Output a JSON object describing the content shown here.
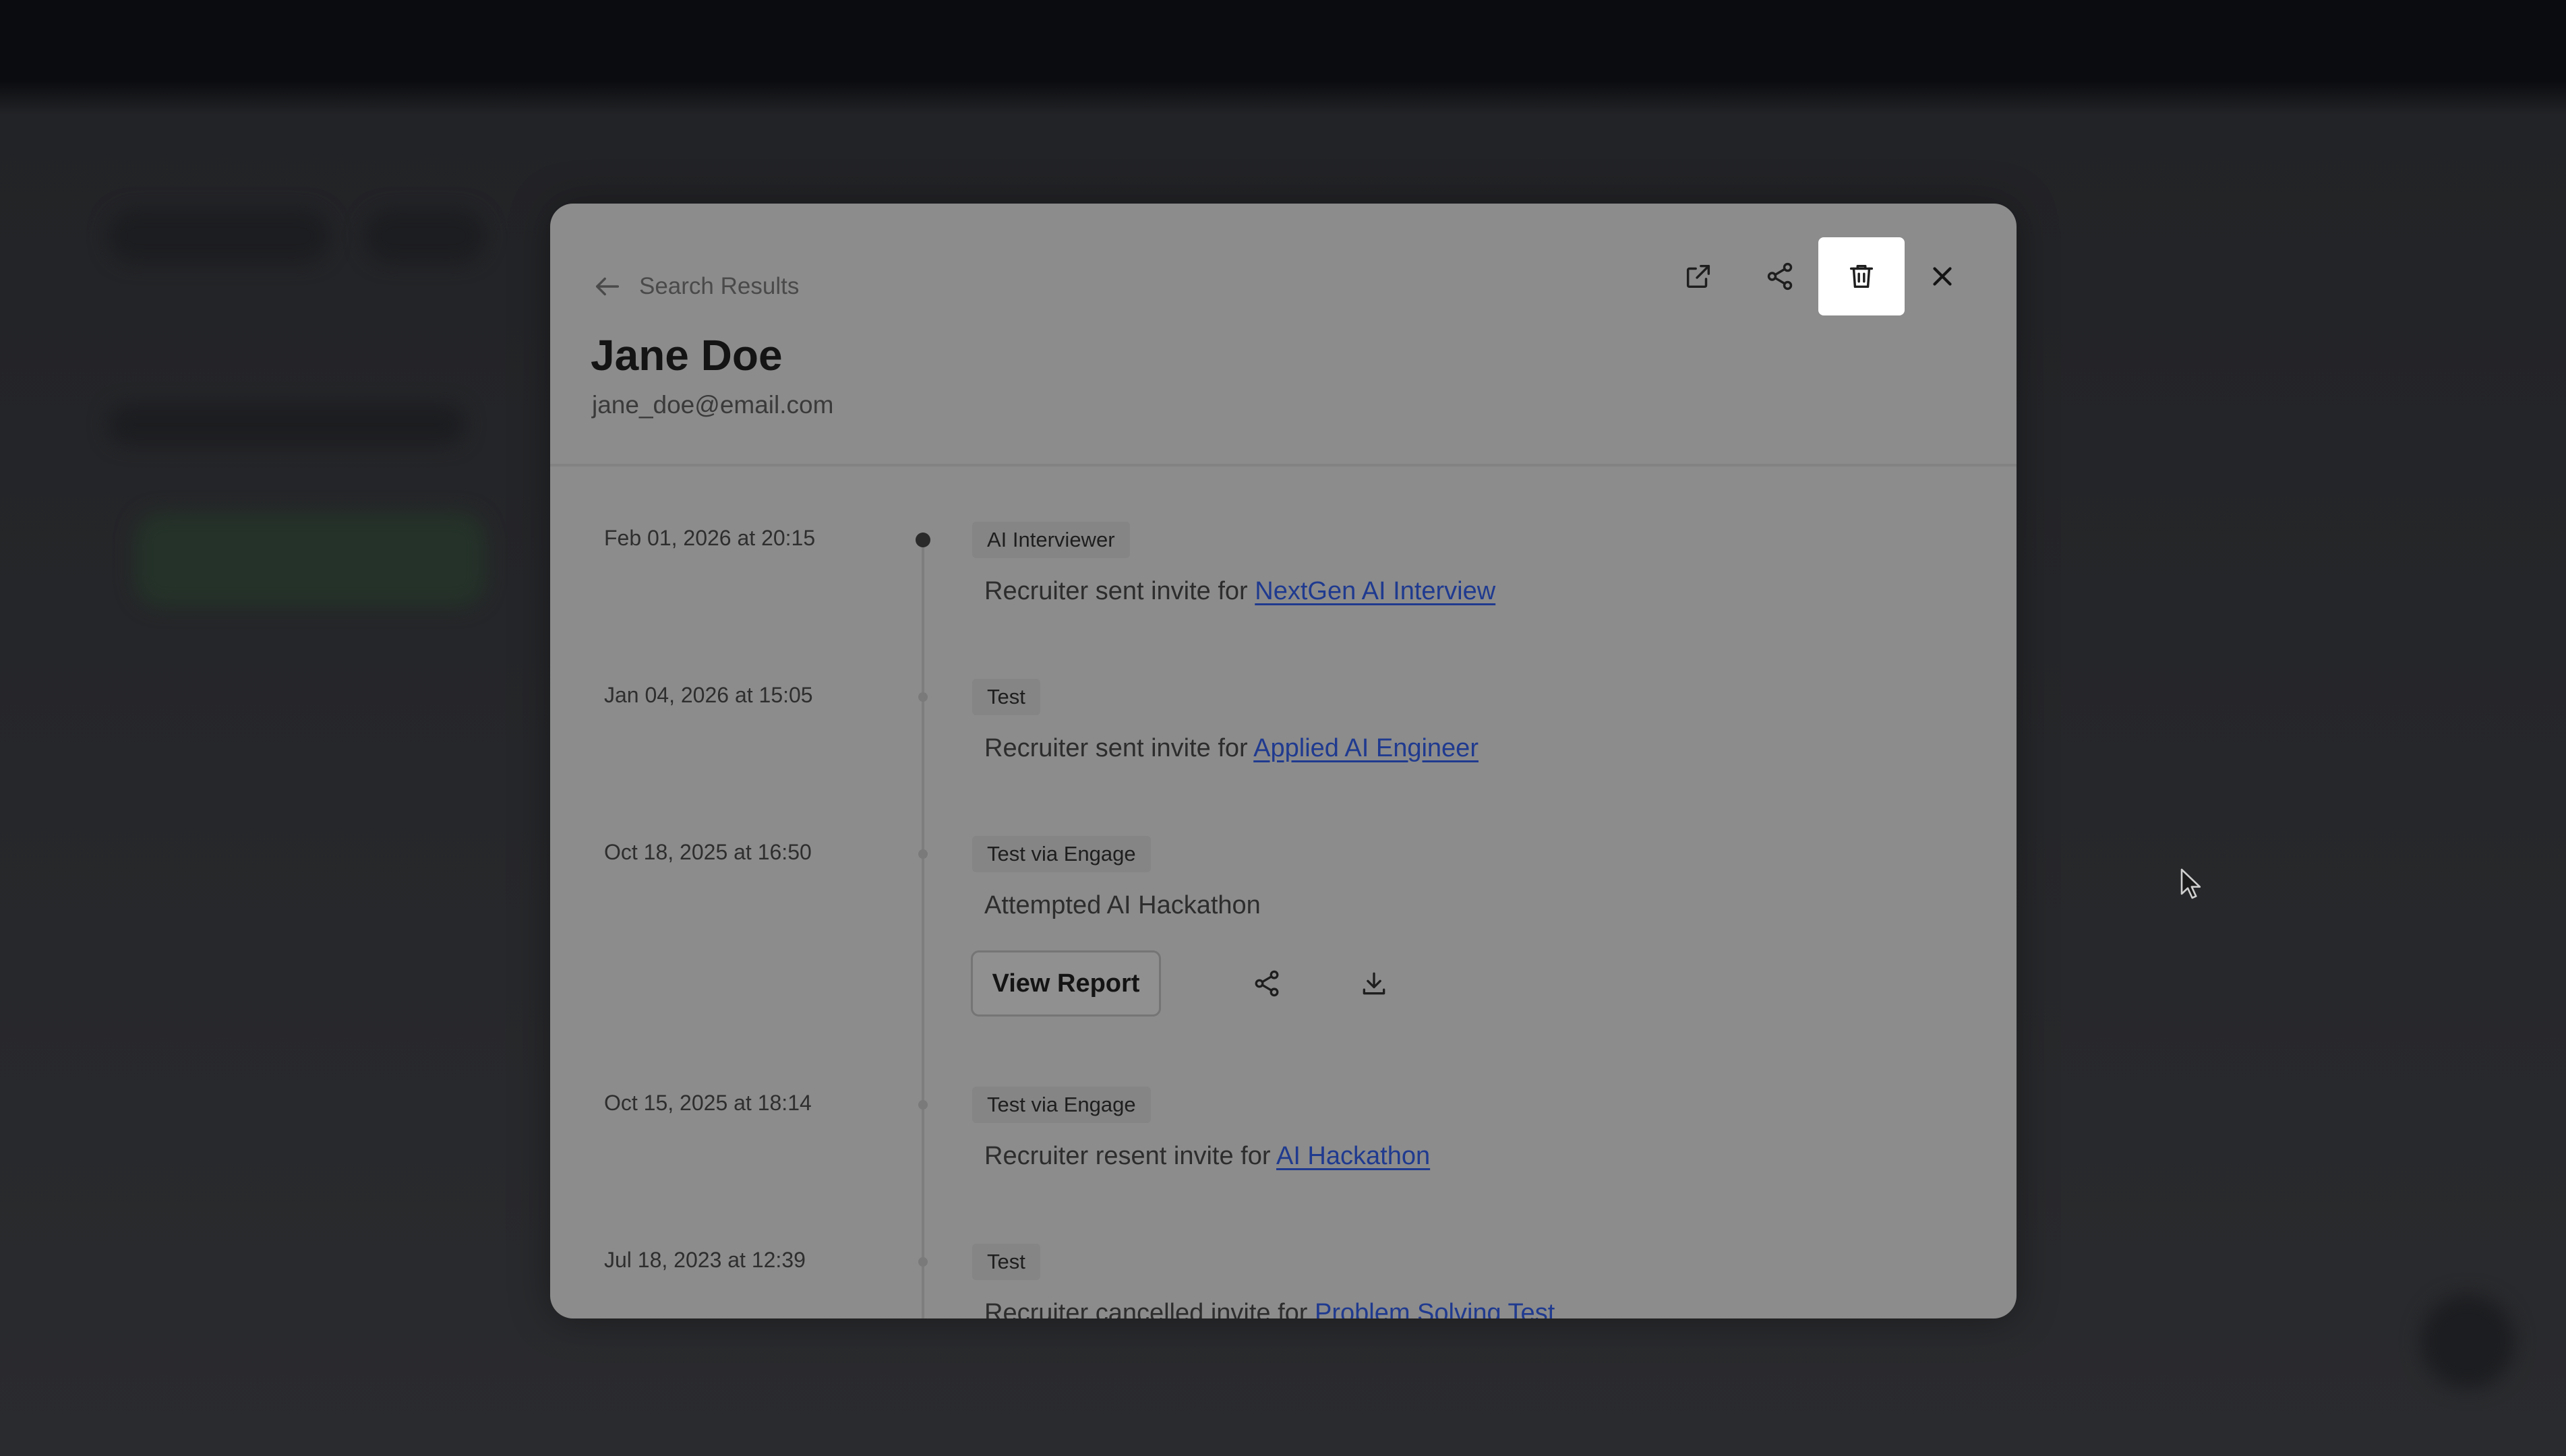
{
  "panel": {
    "back_label": "Search Results",
    "candidate_name": "Jane Doe",
    "candidate_email": "jane_doe@email.com",
    "toolbar_icons": [
      "open-external-icon",
      "share-icon",
      "trash-icon",
      "close-icon"
    ],
    "active_tool": "trash-icon"
  },
  "timeline": [
    {
      "date": "Feb 01, 2026 at 20:15",
      "badge": "AI Interviewer",
      "text": "Recruiter sent invite for ",
      "link": "NextGen AI Interview"
    },
    {
      "date": "Jan 04, 2026 at 15:05",
      "badge": "Test",
      "text": "Recruiter sent invite for ",
      "link": "Applied AI Engineer"
    },
    {
      "date": "Oct 18, 2025 at 16:50",
      "badge": "Test via Engage",
      "text": "Attempted AI Hackathon",
      "action_label": "View Report"
    },
    {
      "date": "Oct 15, 2025 at 18:14",
      "badge": "Test via Engage",
      "text": "Recruiter resent invite for ",
      "link": "AI Hackathon"
    },
    {
      "date": "Jul 18, 2023 at 12:39",
      "badge": "Test",
      "text": "Recruiter cancelled invite for ",
      "link": "Problem Solving Test"
    }
  ],
  "colors": {
    "overlay": "#26272a",
    "panel": "#8c8c8c",
    "link": "#1f3a8f",
    "active_tool_bg": "#ffffff"
  }
}
